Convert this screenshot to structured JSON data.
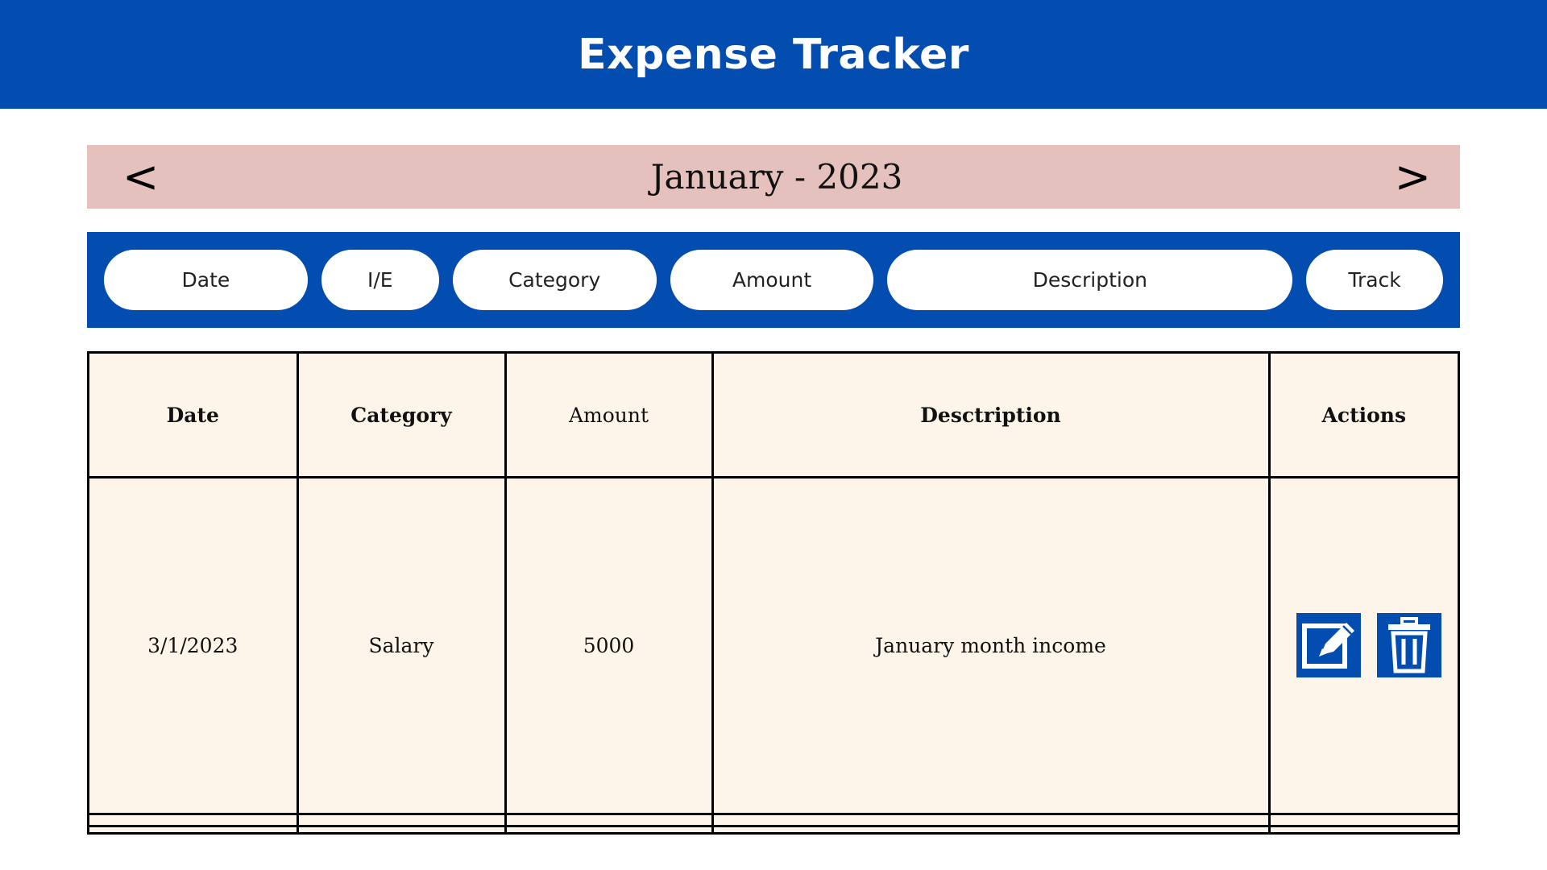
{
  "header": {
    "title": "Expense Tracker"
  },
  "month_nav": {
    "label": "January - 2023",
    "prev_label": "<",
    "next_label": ">"
  },
  "input_bar": {
    "date": "Date",
    "ie": "I/E",
    "category": "Category",
    "amount": "Amount",
    "description": "Description",
    "track": "Track"
  },
  "table": {
    "headers": {
      "date": "Date",
      "category": "Category",
      "amount": "Amount",
      "description": "Desctription",
      "actions": "Actions"
    },
    "rows": [
      {
        "date": "3/1/2023",
        "category": "Salary",
        "amount": "5000",
        "description": "January month income",
        "actions": [
          "edit-icon",
          "trash-icon"
        ]
      },
      {
        "date": "",
        "category": "",
        "amount": "",
        "description": ""
      },
      {
        "date": "",
        "category": "",
        "amount": "",
        "description": ""
      }
    ]
  },
  "colors": {
    "primary_blue": "#034cb0",
    "month_bar": "#e5c1bd",
    "table_bg": "#fdf5e9"
  }
}
